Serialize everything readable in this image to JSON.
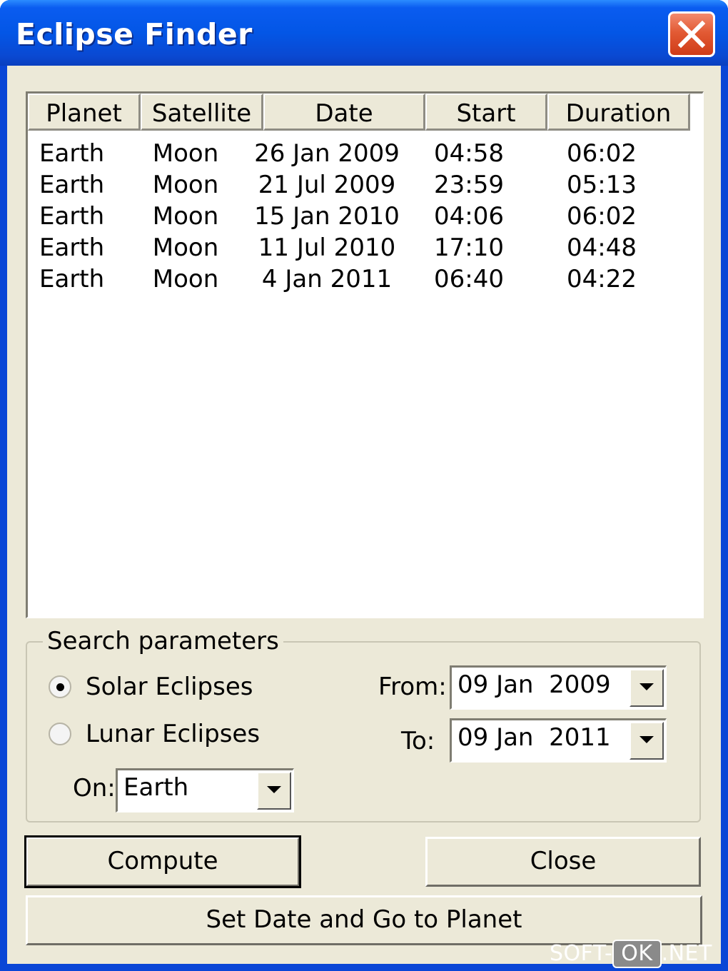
{
  "window": {
    "title": "Eclipse Finder"
  },
  "table": {
    "columns": [
      "Planet",
      "Satellite",
      "Date",
      "Start",
      "Duration"
    ],
    "rows": [
      [
        "Earth",
        "Moon",
        "26 Jan 2009",
        "04:58",
        "06:02"
      ],
      [
        "Earth",
        "Moon",
        "21 Jul 2009",
        "23:59",
        "05:13"
      ],
      [
        "Earth",
        "Moon",
        "15 Jan 2010",
        "04:06",
        "06:02"
      ],
      [
        "Earth",
        "Moon",
        "11 Jul 2010",
        "17:10",
        "04:48"
      ],
      [
        "Earth",
        "Moon",
        "4 Jan 2011",
        "06:40",
        "04:22"
      ]
    ]
  },
  "search": {
    "group_label": "Search parameters",
    "solar_label": "Solar Eclipses",
    "lunar_label": "Lunar Eclipses",
    "selected": "Solar Eclipses",
    "on_label": "On:",
    "on_value": "Earth",
    "from_label": "From:",
    "from_value": "09 Jan  2009",
    "to_label": "To:",
    "to_value": "09 Jan  2011"
  },
  "buttons": {
    "compute": "Compute",
    "close": "Close",
    "set_date": "Set Date and Go to Planet"
  },
  "watermark": {
    "left": "SOFT-",
    "ok": "OK",
    "right": ".NET"
  },
  "icons": {
    "close": "close-icon",
    "dropdown": "chevron-down-icon",
    "radio_selected": "radio-selected",
    "radio_unselected": "radio-unselected"
  },
  "colors": {
    "titlebar": "#0356e6",
    "close_button": "#e25a34",
    "dialog_bg": "#ece9d8"
  }
}
